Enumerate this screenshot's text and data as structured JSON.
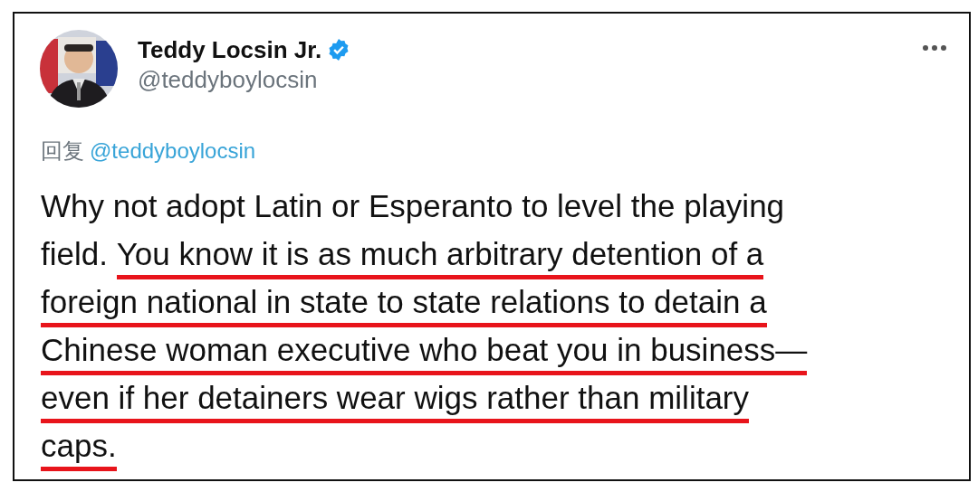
{
  "author": {
    "name": "Teddy Locsin Jr.",
    "verified": true,
    "handle": "@teddyboylocsin"
  },
  "reply_to": {
    "label": "回复",
    "handle": "@teddyboylocsin"
  },
  "body_lines": [
    [
      {
        "text": "Why not adopt Latin or Esperanto to level the playing",
        "underlined": false
      }
    ],
    [
      {
        "text": "field. ",
        "underlined": false
      },
      {
        "text": "You know it is as much arbitrary detention of a",
        "underlined": true
      }
    ],
    [
      {
        "text": "foreign national in state to state relations to detain a",
        "underlined": true
      }
    ],
    [
      {
        "text": "Chinese woman executive who beat you in business—",
        "underlined": true
      }
    ],
    [
      {
        "text": "even if her detainers wear wigs rather than military",
        "underlined": true
      }
    ],
    [
      {
        "text": "caps.",
        "underlined": true
      }
    ]
  ]
}
